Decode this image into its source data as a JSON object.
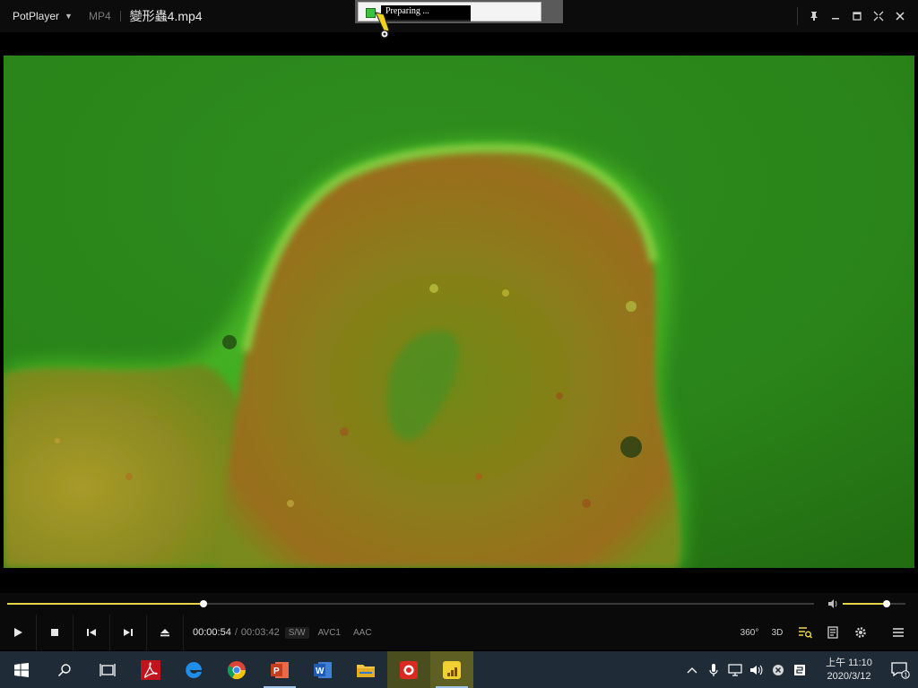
{
  "titlebar": {
    "app_name": "PotPlayer",
    "format": "MP4",
    "file_title": "變形蟲4.mp4"
  },
  "popup": {
    "label": "Preparing ..."
  },
  "playback": {
    "current_time": "00:00:54",
    "separator": "/",
    "total_time": "00:03:42",
    "progress_fraction": 0.243,
    "volume_fraction": 0.7,
    "badges": [
      "S/W",
      "AVC1",
      "AAC"
    ]
  },
  "controls": {
    "right_icons": [
      "360-icon",
      "3d-icon",
      "playlist-search-icon",
      "chapter-icon",
      "settings-gear-icon",
      "menu-icon"
    ],
    "label_360": "360°",
    "label_3d": "3D"
  },
  "taskbar": {
    "apps": [
      "windows-start",
      "search",
      "task-view",
      "acrobat",
      "edge",
      "chrome",
      "powerpoint",
      "word",
      "file-explorer",
      "recorder",
      "potplayer"
    ],
    "clock_time": "上午 11:10",
    "clock_date": "2020/3/12",
    "notification_count": "1"
  },
  "colors": {
    "seek_accent": "#e8d24a",
    "video_bg": "#2c8a1c",
    "taskbar_bg": "#1f2b36"
  }
}
